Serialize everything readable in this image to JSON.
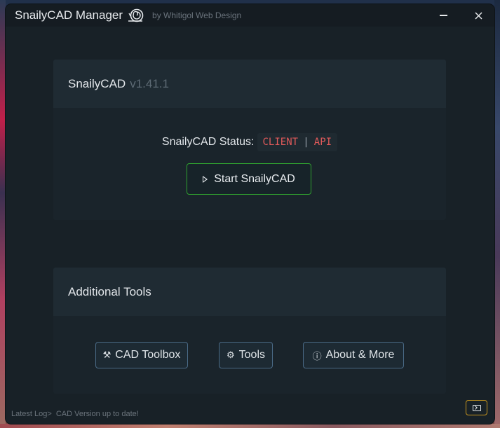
{
  "window": {
    "title": "SnailyCAD Manager",
    "byline": "by Whitigol Web Design"
  },
  "main_card": {
    "name": "SnailyCAD",
    "version": "v1.41.1",
    "status_label": "SnailyCAD Status:",
    "status_client": "CLIENT",
    "status_separator": "|",
    "status_api": "API",
    "start_label": "Start SnailyCAD"
  },
  "tools_card": {
    "title": "Additional Tools",
    "buttons": [
      {
        "label": "CAD Toolbox",
        "icon": "tools-icon"
      },
      {
        "label": "Tools",
        "icon": "gear-icon"
      },
      {
        "label": "About & More",
        "icon": "info-icon"
      }
    ]
  },
  "footer": {
    "log_prefix": "Latest Log>",
    "log_message": "CAD Version up to date!"
  },
  "colors": {
    "status_down": "#e05a5a",
    "start_border": "#2fa02f",
    "tool_border": "#4a6a86",
    "terminal_border": "#c8961e"
  }
}
